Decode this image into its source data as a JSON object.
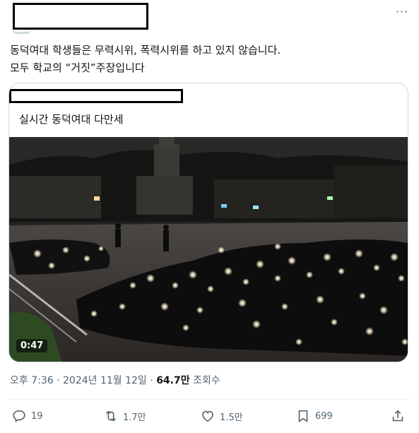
{
  "header": {
    "more_icon": "ellipsis-icon",
    "more_label": "···"
  },
  "tweet": {
    "line1": "동덕여대 학생들은 무력시위, 폭력시위를 하고 있지 않습니다.",
    "line2": "모두 학교의 “거짓”주장입니다"
  },
  "quote": {
    "text": "실시간 동덕여대 다만세",
    "video_duration": "0:47"
  },
  "meta": {
    "time": "오후 7:36",
    "separator": " · ",
    "date": "2024년 11월 12일",
    "views_count": "64.7만",
    "views_label": "조회수"
  },
  "actions": {
    "reply": {
      "icon": "reply-icon",
      "count": "19"
    },
    "repost": {
      "icon": "repost-icon",
      "count": "1.7만"
    },
    "like": {
      "icon": "heart-icon",
      "count": "1.5만"
    },
    "bookmark": {
      "icon": "bookmark-icon",
      "count": "699"
    },
    "share": {
      "icon": "share-icon"
    }
  },
  "colors": {
    "secondary_text": "#536471",
    "border": "#cfd9de",
    "primary_text": "#0f1419"
  }
}
